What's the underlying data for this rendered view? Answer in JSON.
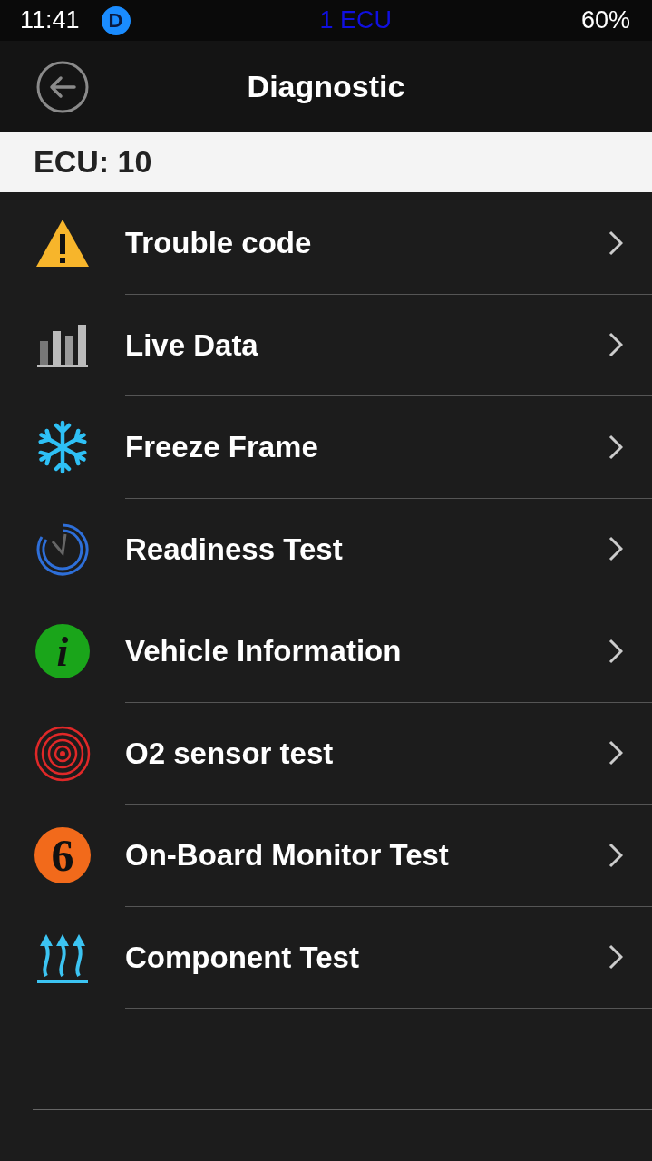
{
  "status_bar": {
    "time": "11:41",
    "app_badge": "D",
    "center": "1 ECU",
    "battery": "60%"
  },
  "header": {
    "title": "Diagnostic"
  },
  "section": {
    "label": "ECU: 10"
  },
  "items": [
    {
      "label": "Trouble code",
      "kind": "warning"
    },
    {
      "label": "Live Data",
      "kind": "bars"
    },
    {
      "label": "Freeze Frame",
      "kind": "snowflake"
    },
    {
      "label": "Readiness Test",
      "kind": "gauge"
    },
    {
      "label": "Vehicle Information",
      "kind": "info",
      "glyph": "i"
    },
    {
      "label": "O2 sensor test",
      "kind": "rings"
    },
    {
      "label": "On-Board Monitor Test",
      "kind": "number",
      "glyph": "6"
    },
    {
      "label": "Component Test",
      "kind": "heat"
    }
  ]
}
